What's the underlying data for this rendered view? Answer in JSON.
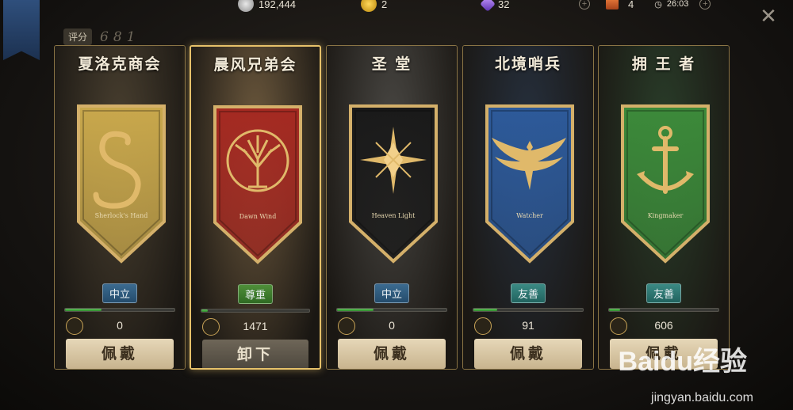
{
  "top_bar": {
    "silver": "192,444",
    "gold": "2",
    "gems": "32",
    "tickets": "4",
    "timer": "26:03"
  },
  "rating": {
    "label": "评分",
    "value": "681"
  },
  "factions": [
    {
      "name": "夏洛克商会",
      "emblem_text": "Sherlock's Hand",
      "emblem": "snake-icon",
      "banner_color": "#c9a84c",
      "bg": "#4a4030",
      "status": "中立",
      "status_type": "neutral",
      "progress": 0.33,
      "rep": "0",
      "rep_icon": "snake-icon",
      "action": "佩戴",
      "action_type": "wear"
    },
    {
      "name": "晨风兄弟会",
      "emblem_text": "Dawn Wind",
      "emblem": "tree-icon",
      "banner_color": "#a52a22",
      "bg": "#6e5a3e",
      "status": "尊重",
      "status_type": "respect",
      "progress": 0.06,
      "rep": "1471",
      "rep_icon": "tree-icon",
      "action": "卸下",
      "action_type": "remove"
    },
    {
      "name": "圣  堂",
      "emblem_text": "Heaven Light",
      "emblem": "star-icon",
      "banner_color": "#1a1a1a",
      "bg": "#4a4844",
      "status": "中立",
      "status_type": "neutral",
      "progress": 0.33,
      "rep": "0",
      "rep_icon": "star-icon",
      "action": "佩戴",
      "action_type": "wear"
    },
    {
      "name": "北境哨兵",
      "emblem_text": "Watcher",
      "emblem": "phoenix-icon",
      "banner_color": "#2d5a9a",
      "bg": "#26303e",
      "status": "友善",
      "status_type": "friendly",
      "progress": 0.22,
      "rep": "91",
      "rep_icon": "phoenix-icon",
      "action": "佩戴",
      "action_type": "wear"
    },
    {
      "name": "拥 王 者",
      "emblem_text": "Kingmaker",
      "emblem": "anchor-icon",
      "banner_color": "#3c8a3a",
      "bg": "#2a3e2a",
      "status": "友善",
      "status_type": "friendly",
      "progress": 0.1,
      "rep": "606",
      "rep_icon": "anchor-icon",
      "action": "佩戴",
      "action_type": "wear"
    }
  ],
  "watermark": {
    "brand": "Baidu经验",
    "url": "jingyan.baidu.com"
  },
  "colors": {
    "gold_border": "#e6c16a",
    "progress_green": "#5fc35a"
  }
}
